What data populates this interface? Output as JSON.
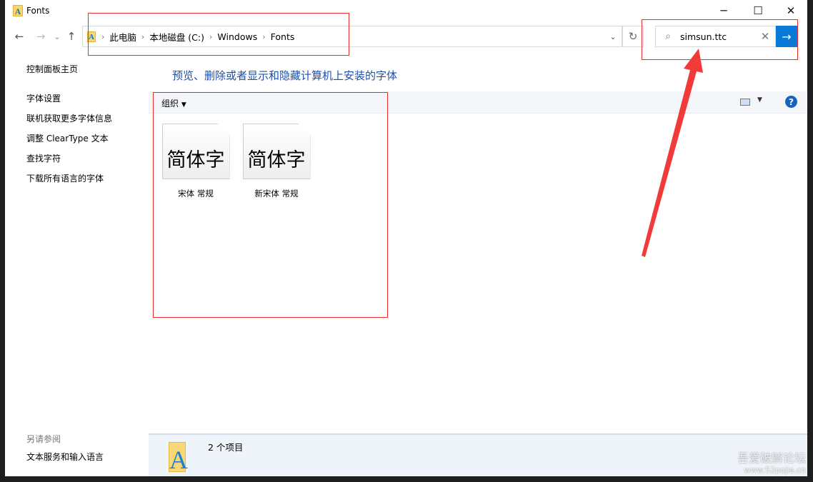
{
  "window": {
    "title": "Fonts",
    "minimize": "─",
    "maximize": "☐",
    "close": "✕"
  },
  "nav": {
    "back": "←",
    "forward": "→",
    "recent": "⌄",
    "up": "↑"
  },
  "address": {
    "segments": [
      "此电脑",
      "本地磁盘 (C:)",
      "Windows",
      "Fonts"
    ],
    "separator": "›",
    "dropdown": "⌄",
    "refresh": "↻"
  },
  "search": {
    "value": "simsun.ttc",
    "icon": "⌕",
    "clear": "✕",
    "go": "→"
  },
  "sidebar": {
    "home": "控制面板主页",
    "items": [
      "字体设置",
      "联机获取更多字体信息",
      "调整 ClearType 文本",
      "查找字符",
      "下载所有语言的字体"
    ],
    "see_also": "另请参阅",
    "see_also_link": "文本服务和输入语言"
  },
  "main": {
    "heading": "预览、删除或者显示和隐藏计算机上安装的字体",
    "organize": "组织",
    "help": "?"
  },
  "files": [
    {
      "preview": "简体字",
      "name": "宋体 常规"
    },
    {
      "preview": "简体字",
      "name": "新宋体 常规"
    }
  ],
  "status": {
    "count": "2 个项目",
    "icon_letter": "A"
  },
  "watermark": {
    "line1": "吾爱破解论坛",
    "line2": "www.52pojie.cn"
  },
  "colors": {
    "accent": "#0a78d7",
    "heading": "#1e4fa8",
    "annotation": "#ee2b2b"
  }
}
